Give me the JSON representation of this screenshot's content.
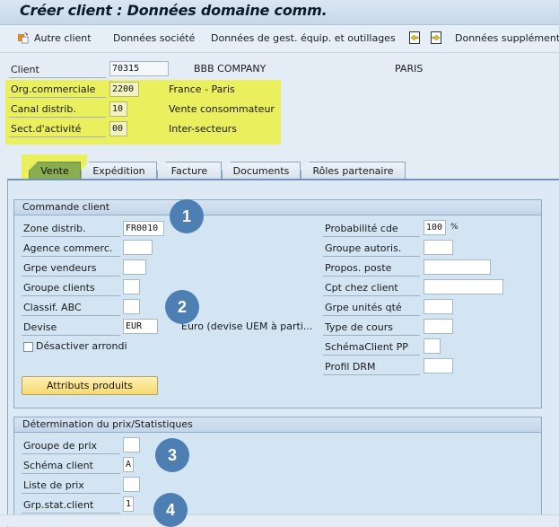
{
  "window": {
    "title": "Créer client : Données domaine comm."
  },
  "toolbar": {
    "items": [
      {
        "label": "Autre client",
        "icon": "switch-customer-icon"
      },
      {
        "label": "Données société"
      },
      {
        "label": "Données de gest. équip. et outillages"
      },
      {
        "label": "",
        "icon": "previous-screen-icon"
      },
      {
        "label": "",
        "icon": "next-screen-icon"
      },
      {
        "label": "Données supplément"
      }
    ]
  },
  "header": {
    "client": {
      "label": "Client",
      "value": "70315",
      "name": "BBB COMPANY",
      "city": "PARIS"
    },
    "sales_org": {
      "label": "Org.commerciale",
      "value": "2200",
      "desc": "France - Paris"
    },
    "dist_channel": {
      "label": "Canal distrib.",
      "value": "10",
      "desc": "Vente consommateur"
    },
    "division": {
      "label": "Sect.d'activité",
      "value": "00",
      "desc": "Inter-secteurs"
    },
    "highlight_color": "#eaef5e"
  },
  "tabs": [
    {
      "label": "Vente",
      "active": true
    },
    {
      "label": "Expédition",
      "active": false
    },
    {
      "label": "Facture",
      "active": false
    },
    {
      "label": "Documents",
      "active": false
    },
    {
      "label": "Rôles partenaire",
      "active": false
    }
  ],
  "order_frame": {
    "title": "Commande client",
    "left_fields": [
      {
        "label": "Zone distrib.",
        "value": "FR0010"
      },
      {
        "label": "Agence commerc.",
        "value": ""
      },
      {
        "label": "Grpe vendeurs",
        "value": ""
      },
      {
        "label": "Groupe clients",
        "value": ""
      },
      {
        "label": "Classif. ABC",
        "value": ""
      },
      {
        "label": "Devise",
        "value": "EUR",
        "desc": "Euro (devise UEM à parti..."
      }
    ],
    "checkbox": {
      "label": "Désactiver arrondi",
      "checked": false
    },
    "button": {
      "label": "Attributs produits"
    },
    "right_fields": [
      {
        "label": "Probabilité cde",
        "value": "100",
        "unit": "%"
      },
      {
        "label": "Groupe autoris.",
        "value": ""
      },
      {
        "label": "Propos. poste",
        "value": ""
      },
      {
        "label": "Cpt chez client",
        "value": ""
      },
      {
        "label": "Grpe unités qté",
        "value": ""
      },
      {
        "label": "Type de cours",
        "value": ""
      },
      {
        "label": "SchémaClient PP",
        "value": ""
      },
      {
        "label": "Profil DRM",
        "value": ""
      }
    ]
  },
  "pricing_frame": {
    "title": "Détermination du prix/Statistiques",
    "fields": [
      {
        "label": "Groupe de prix",
        "value": ""
      },
      {
        "label": "Schéma client",
        "value": "A"
      },
      {
        "label": "Liste de prix",
        "value": ""
      },
      {
        "label": "Grp.stat.client",
        "value": "1"
      }
    ]
  },
  "callouts": [
    "1",
    "2",
    "3",
    "4"
  ],
  "colors": {
    "badge": "#4e7fb3",
    "active_tab": "#8aad4f",
    "button": "#f7d96e"
  }
}
